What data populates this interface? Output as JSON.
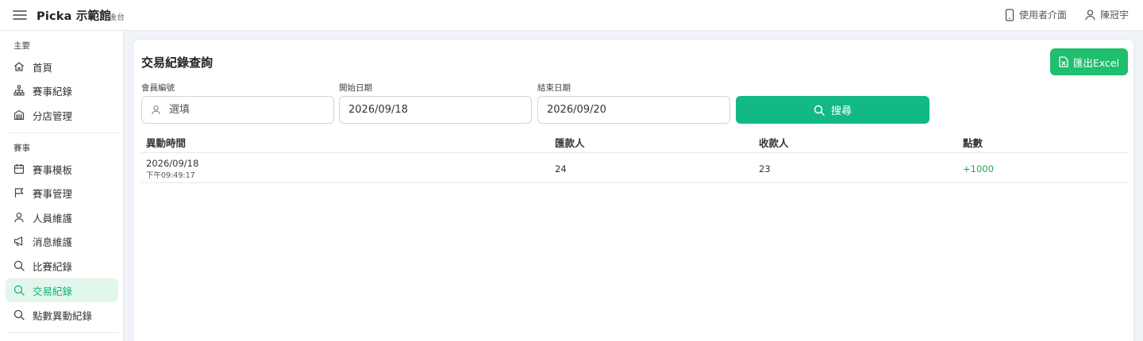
{
  "header": {
    "brand": "Picka 示範館",
    "brand_sub": "後台",
    "user_view_label": "使用者介面",
    "user_name": "陳冠宇"
  },
  "sidebar": {
    "sections": [
      {
        "title": "主要",
        "items": [
          {
            "label": "首頁",
            "icon": "home-icon"
          },
          {
            "label": "賽事紀錄",
            "icon": "sitemap-icon"
          },
          {
            "label": "分店管理",
            "icon": "store-icon"
          }
        ]
      },
      {
        "title": "賽事",
        "items": [
          {
            "label": "賽事模板",
            "icon": "calendar-icon"
          },
          {
            "label": "賽事管理",
            "icon": "flag-icon"
          },
          {
            "label": "人員維護",
            "icon": "user-icon"
          },
          {
            "label": "消息維護",
            "icon": "megaphone-icon"
          },
          {
            "label": "比賽紀錄",
            "icon": "search-icon"
          },
          {
            "label": "交易紀錄",
            "icon": "search-icon",
            "active": true
          },
          {
            "label": "點數異動紀錄",
            "icon": "search-icon"
          }
        ]
      }
    ]
  },
  "main": {
    "title": "交易紀錄查詢",
    "export_label": "匯出Excel",
    "filters": {
      "member_label": "會員編號",
      "member_placeholder": "選填",
      "start_label": "開始日期",
      "start_value": "2026/09/18",
      "end_label": "結束日期",
      "end_value": "2026/09/20",
      "search_label": "搜尋"
    },
    "table": {
      "columns": [
        "異動時間",
        "匯款人",
        "收款人",
        "點數"
      ],
      "rows": [
        {
          "date": "2026/09/18",
          "time": "下午09:49:17",
          "sender": "24",
          "receiver": "23",
          "points": "+1000"
        }
      ]
    }
  },
  "colors": {
    "accent": "#12b886",
    "export_green": "#1fbf6e",
    "active_bg": "#e3f6ec",
    "points_positive": "#1fa855"
  }
}
